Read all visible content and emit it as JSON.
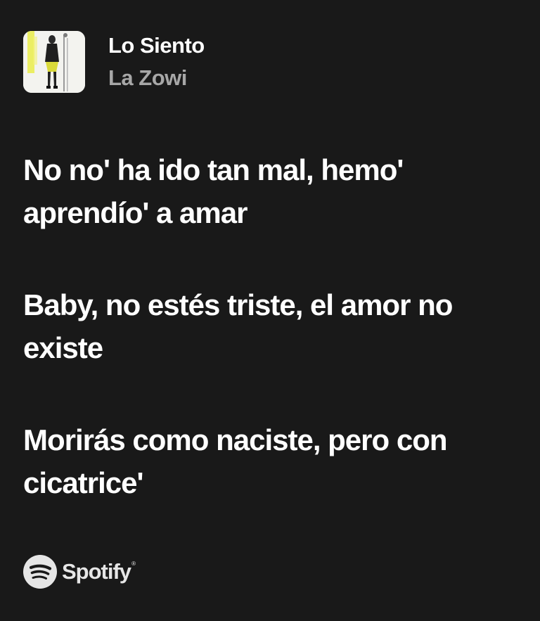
{
  "track": {
    "title": "Lo Siento",
    "artist": "La Zowi",
    "cover_art": "album-cover-image"
  },
  "lyrics": [
    "No no' ha ido tan mal, hemo' aprendío' a amar",
    "Baby, no estés triste, el amor no existe",
    "Morirás como naciste, pero con cicatrice'"
  ],
  "brand": {
    "name": "Spotify",
    "trademark": "®",
    "icon": "spotify-logo-icon"
  },
  "colors": {
    "background": "#191919",
    "title": "#ffffff",
    "artist": "#a7a7a7",
    "brand": "#e6e6e6"
  }
}
